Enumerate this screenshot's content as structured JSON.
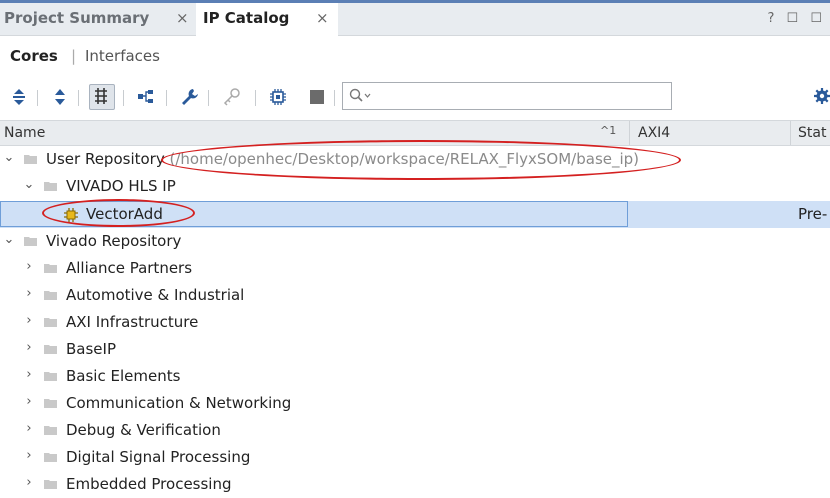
{
  "tabs": [
    {
      "label": "Project Summary",
      "close": "×"
    },
    {
      "label": "IP Catalog",
      "close": "×"
    }
  ],
  "window_tools": [
    "?",
    "☐",
    "☐"
  ],
  "subnav": {
    "cores": "Cores",
    "separator": "|",
    "interfaces": "Interfaces"
  },
  "toolbar": {
    "search_placeholder": "",
    "icons": [
      "collapse-all-icon",
      "expand-all-icon",
      "flat-view-icon",
      "hierarchy-icon",
      "wrench-icon",
      "key-icon",
      "chip-icon",
      "stop-icon",
      "search-icon",
      "gear-icon"
    ]
  },
  "columns": {
    "name": "Name",
    "sort_indicator": "^1",
    "axi4": "AXI4",
    "status": "Stat"
  },
  "tree": {
    "user_repo": {
      "label": "User Repository",
      "path": "(/home/openhec/Desktop/workspace/RELAX_FlyxSOM/base_ip)"
    },
    "vivado_hls": {
      "label": "VIVADO HLS IP"
    },
    "vector_add": {
      "label": "VectorAdd",
      "status": "Pre-"
    },
    "vivado_repo": {
      "label": "Vivado Repository"
    },
    "categories": [
      "Alliance Partners",
      "Automotive & Industrial",
      "AXI Infrastructure",
      "BaseIP",
      "Basic Elements",
      "Communication & Networking",
      "Debug & Verification",
      "Digital Signal Processing",
      "Embedded Processing"
    ]
  },
  "colors": {
    "accent": "#5b7fb5",
    "selection": "#cfe0f6",
    "annotation": "#d42020"
  }
}
